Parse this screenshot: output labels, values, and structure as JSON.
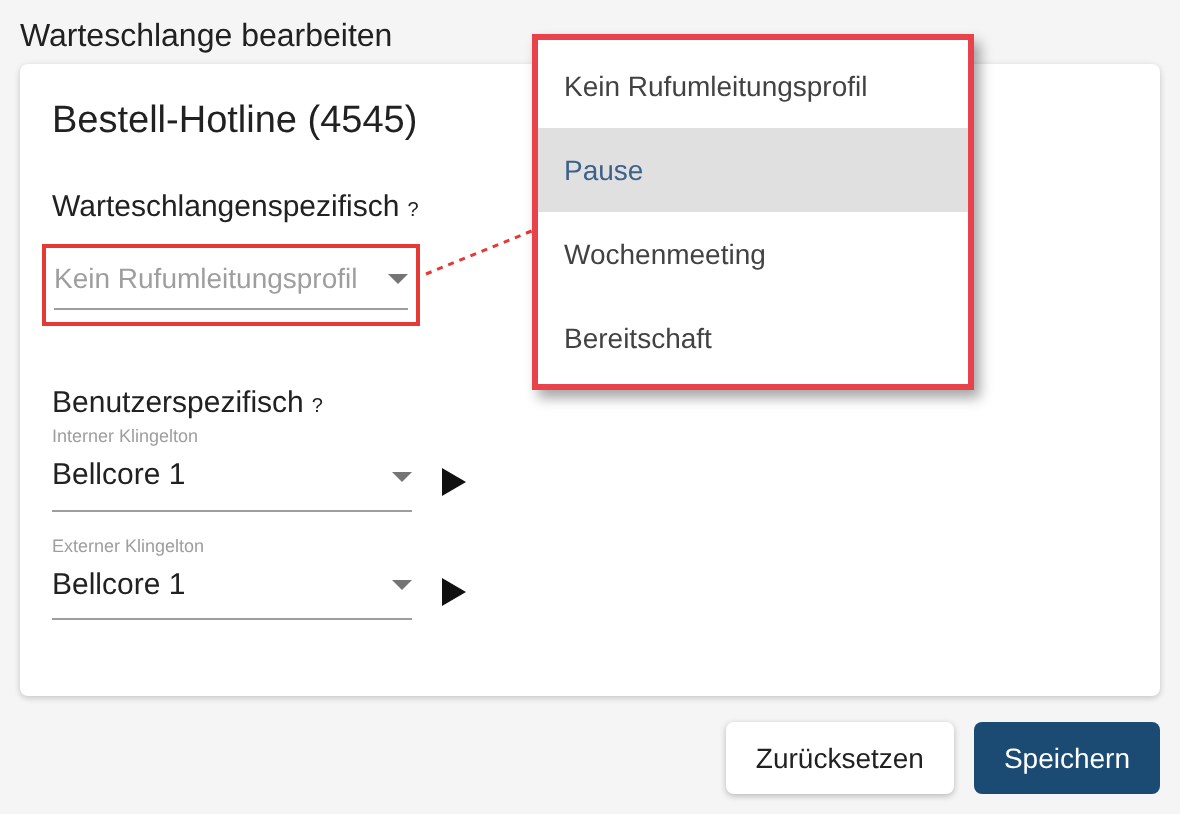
{
  "page_title": "Warteschlange bearbeiten",
  "card": {
    "title": "Bestell-Hotline (4545)",
    "queue_section": {
      "label": "Warteschlangenspezifisch",
      "help": "?",
      "select": {
        "placeholder": "Kein Rufumleitungsprofil",
        "highlighted": true
      }
    },
    "user_section": {
      "label": "Benutzerspezifisch",
      "help": "?",
      "fields": [
        {
          "label": "Interner Klingelton",
          "value": "Bellcore 1"
        },
        {
          "label": "Externer Klingelton",
          "value": "Bellcore 1"
        }
      ]
    }
  },
  "menu": {
    "items": [
      {
        "label": "Kein Rufumleitungsprofil",
        "selected": false
      },
      {
        "label": "Pause",
        "selected": true
      },
      {
        "label": "Wochenmeeting",
        "selected": false
      },
      {
        "label": "Bereitschaft",
        "selected": false
      }
    ]
  },
  "buttons": [
    {
      "label": "Zurücksetzen",
      "kind": "secondary"
    },
    {
      "label": "Speichern",
      "kind": "primary"
    }
  ]
}
